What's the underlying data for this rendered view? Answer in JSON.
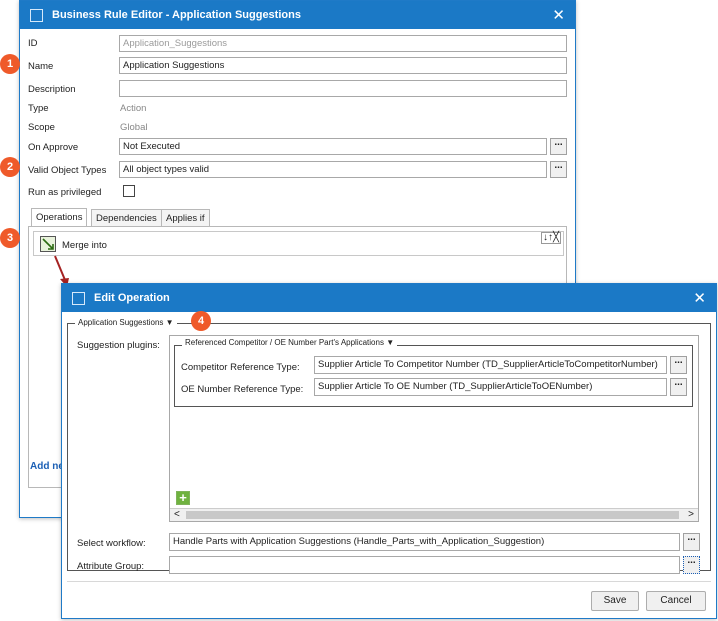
{
  "bre": {
    "title": "Business Rule Editor - Application Suggestions",
    "fields": {
      "id_label": "ID",
      "id_value": "Application_Suggestions",
      "name_label": "Name",
      "name_value": "Application Suggestions",
      "description_label": "Description",
      "description_value": "",
      "type_label": "Type",
      "type_value": "Action",
      "scope_label": "Scope",
      "scope_value": "Global",
      "on_approve_label": "On Approve",
      "on_approve_value": "Not Executed",
      "valid_types_label": "Valid Object Types",
      "valid_types_value": "All object types valid",
      "privileged_label": "Run as privileged"
    },
    "tabs": [
      "Operations",
      "Dependencies",
      "Applies if"
    ],
    "operation": {
      "label": "Merge  into",
      "controls": "↓↑╳"
    },
    "add_link": "Add ne",
    "ellipsis": "..."
  },
  "badges": [
    "1",
    "2",
    "3",
    "4"
  ],
  "eo": {
    "title": "Edit Operation",
    "group_label": "Application Suggestions",
    "plugins_label": "Suggestion plugins:",
    "inner_group_label": "Referenced Competitor / OE Number Part's Applications",
    "competitor_label": "Competitor Reference Type:",
    "competitor_value": "Supplier Article To Competitor Number (TD_SupplierArticleToCompetitorNumber)",
    "oe_label": "OE Number Reference Type:",
    "oe_value": "Supplier Article To OE Number (TD_SupplierArticleToOENumber)",
    "workflow_label": "Select workflow:",
    "workflow_value": "Handle Parts with Application Suggestions (Handle_Parts_with_Application_Suggestion)",
    "attr_group_label": "Attribute Group:",
    "attr_group_value": "",
    "save": "Save",
    "cancel": "Cancel",
    "plus": "+",
    "scroll_left": "<",
    "scroll_right": ">",
    "ellipsis": "..."
  },
  "colors": {
    "titlebar": "#1b79c6",
    "badge": "#ef5a2a",
    "arrow": "#a52222",
    "link": "#1b5fb5"
  }
}
